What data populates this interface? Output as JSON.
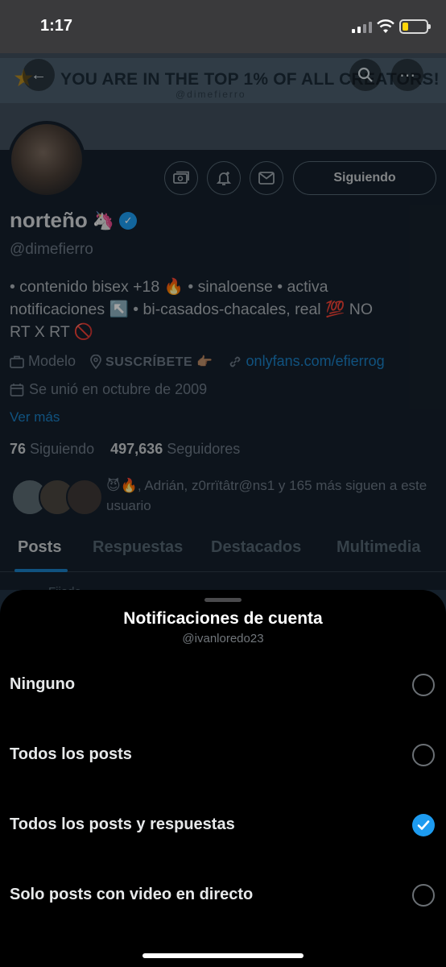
{
  "status_bar": {
    "time": "1:17"
  },
  "banner": {
    "text": "YOU ARE IN THE TOP 1% OF ALL CREATORS!",
    "watermark": "@dimefierro"
  },
  "profile": {
    "display_name": "norteño",
    "handle": "@dimefierro",
    "following_button": "Siguiendo",
    "bio_line1": "• contenido bisex +18 🔥 • sinaloense • activa",
    "bio_line2": "notificaciones ↖️ • bi-casados-chacales, real 💯  NO",
    "bio_line3": "RT X RT 🚫",
    "category": "Modelo",
    "location": "SUSCRÍBETE 👉🏽",
    "link": "onlyfans.com/efierrog",
    "joined": "Se unió en octubre de 2009",
    "see_more": "Ver más",
    "following_count": "76",
    "following_label": "Siguiendo",
    "followers_count": "497,636",
    "followers_label": "Seguidores",
    "followed_by": "😈🔥, Adrián, z0rrïtâtr@ns1 y 165 más siguen a este usuario"
  },
  "tabs": [
    {
      "label": "Posts",
      "active": true
    },
    {
      "label": "Respuestas",
      "active": false
    },
    {
      "label": "Destacados",
      "active": false
    },
    {
      "label": "Multimedia",
      "active": false
    }
  ],
  "pinned_label": "Fijado",
  "sheet": {
    "title": "Notificaciones de cuenta",
    "subtitle": "@ivanloredo23",
    "options": [
      {
        "label": "Ninguno",
        "selected": false
      },
      {
        "label": "Todos los posts",
        "selected": false
      },
      {
        "label": "Todos los posts y respuestas",
        "selected": true
      },
      {
        "label": "Solo posts con video en directo",
        "selected": false
      }
    ]
  },
  "colors": {
    "accent": "#1d9bf0",
    "background": "#15202b",
    "sheet": "#000000"
  }
}
